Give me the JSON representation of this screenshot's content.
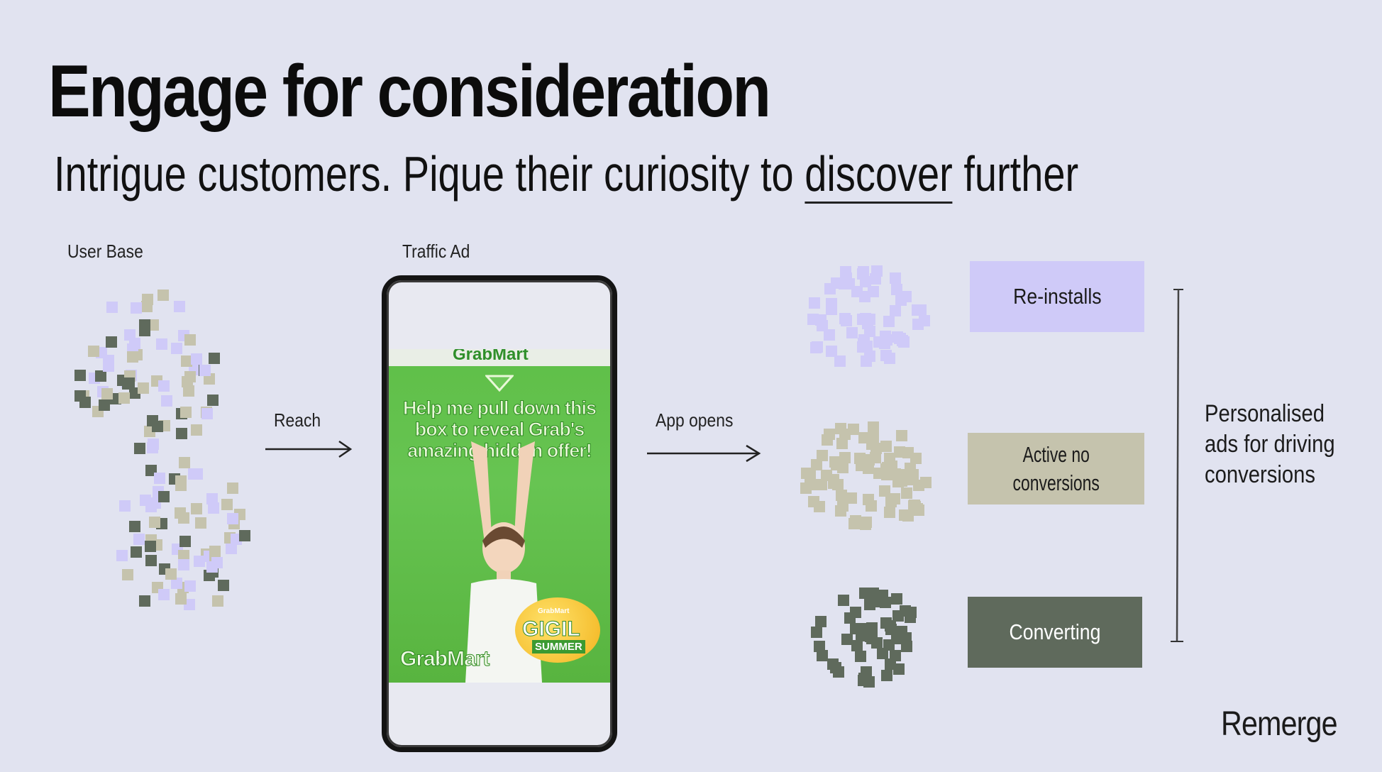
{
  "slide": {
    "title": "Engage for consideration",
    "subtitle_before": "Intrigue customers. Pique their curiosity to ",
    "subtitle_emphasis": "discover",
    "subtitle_after": " further"
  },
  "labels": {
    "user_base": "User Base",
    "traffic_ad": "Traffic Ad",
    "reach": "Reach",
    "app_opens": "App opens"
  },
  "ad": {
    "top_brand": "GrabMart",
    "message": "Help me pull down this box to reveal Grab's amazing hidden offer!",
    "brand": "GrabMart",
    "badge_brand": "GrabMart",
    "badge_title": "GIGIL",
    "badge_subtitle": "SUMMER"
  },
  "segments": [
    {
      "label_line1": "Re-installs",
      "label_line2": "",
      "color": "#cfcaf8"
    },
    {
      "label_line1": "Active no",
      "label_line2": "conversions",
      "color": "#c5c3ad"
    },
    {
      "label_line1": "Converting",
      "label_line2": "",
      "color": "#5f6a5c"
    }
  ],
  "bracket_text": [
    "Personalised",
    "ads for driving",
    "conversions"
  ],
  "brand_logo": "Remerge",
  "colors": {
    "background": "#e1e3f0",
    "lavender": "#cfcaf8",
    "beige": "#c5c3ad",
    "dark_green": "#5f6a5c"
  }
}
